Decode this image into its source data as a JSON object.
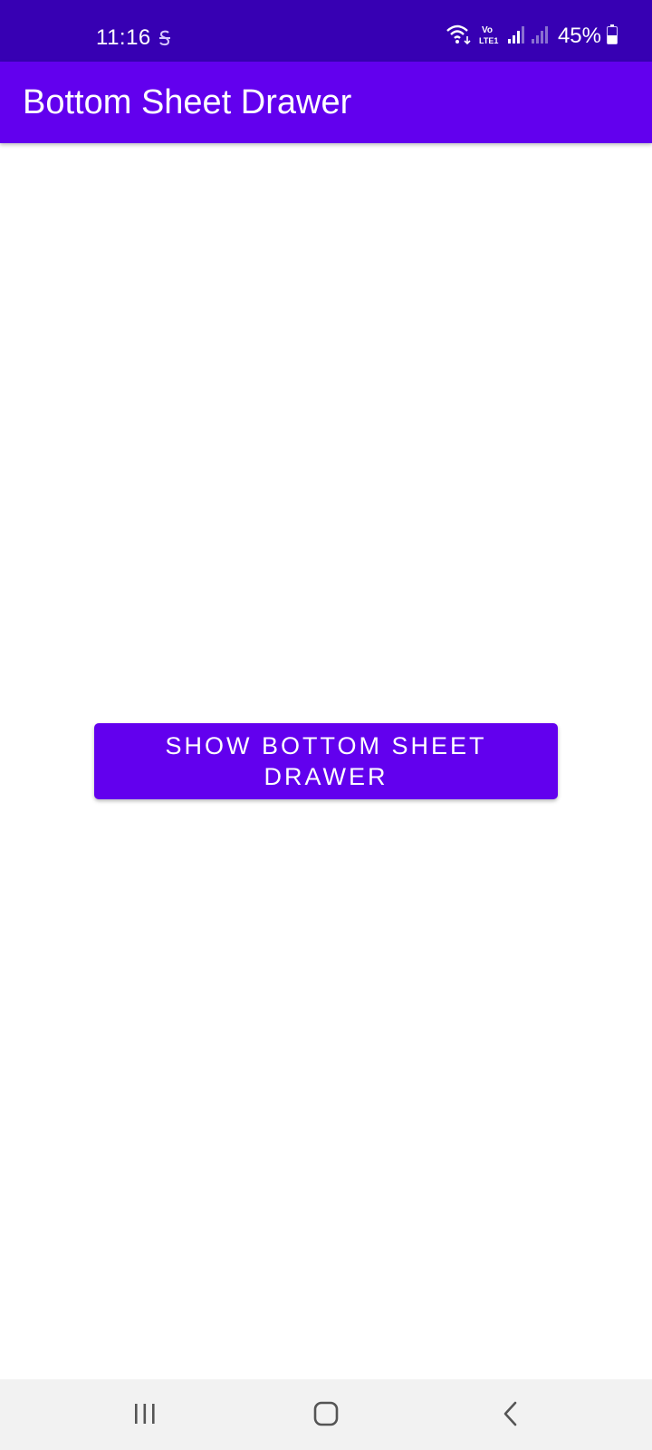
{
  "status_bar": {
    "time": "11:16",
    "battery_percent": "45%",
    "icons": [
      "s-icon",
      "wifi-icon",
      "volte-icon",
      "signal-1-icon",
      "signal-2-icon",
      "battery-icon"
    ]
  },
  "app_bar": {
    "title": "Bottom Sheet Drawer"
  },
  "main": {
    "button_label": "SHOW BOTTOM SHEET DRAWER"
  },
  "nav_bar": {
    "buttons": [
      "recents-icon",
      "home-icon",
      "back-icon"
    ]
  },
  "colors": {
    "status_bar": "#3700b3",
    "primary": "#6200ee",
    "on_primary": "#ffffff",
    "nav_bar": "#f2f2f2"
  }
}
